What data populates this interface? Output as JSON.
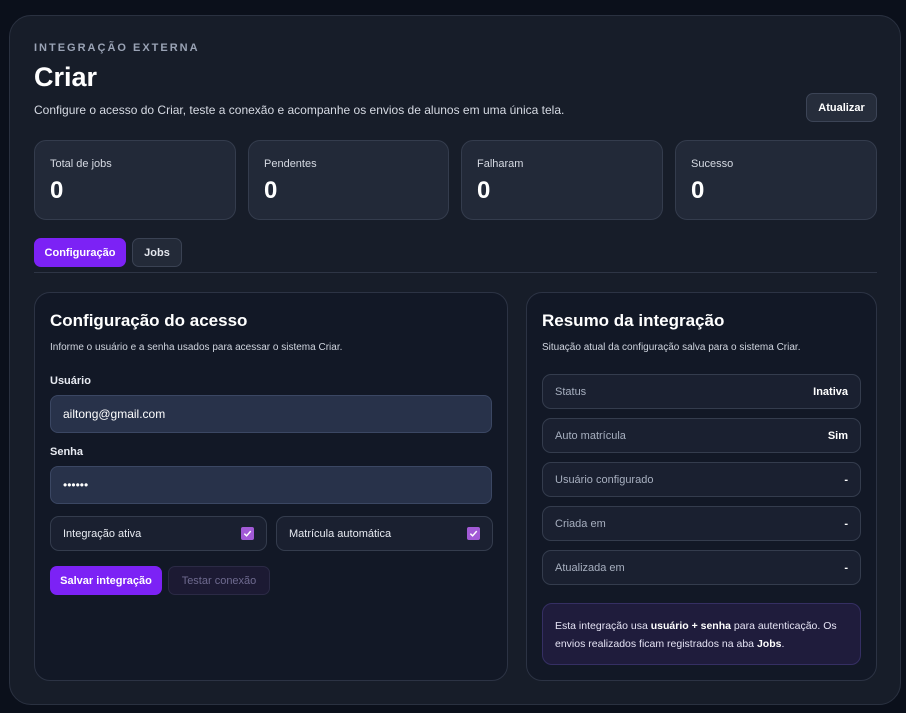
{
  "header": {
    "eyebrow": "INTEGRAÇÃO EXTERNA",
    "title": "Criar",
    "subtitle": "Configure o acesso do Criar, teste a conexão e acompanhe os envios de alunos em uma única tela.",
    "refresh_label": "Atualizar"
  },
  "stats": [
    {
      "label": "Total de jobs",
      "value": "0"
    },
    {
      "label": "Pendentes",
      "value": "0"
    },
    {
      "label": "Falharam",
      "value": "0"
    },
    {
      "label": "Sucesso",
      "value": "0"
    }
  ],
  "tabs": [
    {
      "label": "Configuração",
      "active": true
    },
    {
      "label": "Jobs",
      "active": false
    }
  ],
  "config": {
    "title": "Configuração do acesso",
    "description": "Informe o usuário e a senha usados para acessar o sistema Criar.",
    "user_label": "Usuário",
    "user_value": "ailtong@gmail.com",
    "password_label": "Senha",
    "password_value": "••••••",
    "toggle_active_label": "Integração ativa",
    "toggle_active_checked": true,
    "toggle_auto_label": "Matrícula automática",
    "toggle_auto_checked": true,
    "save_label": "Salvar integração",
    "test_label": "Testar conexão"
  },
  "summary": {
    "title": "Resumo da integração",
    "description": "Situação atual da configuração salva para o sistema Criar.",
    "rows": [
      {
        "key": "Status",
        "value": "Inativa"
      },
      {
        "key": "Auto matrícula",
        "value": "Sim"
      },
      {
        "key": "Usuário configurado",
        "value": "-"
      },
      {
        "key": "Criada em",
        "value": "-"
      },
      {
        "key": "Atualizada em",
        "value": "-"
      }
    ],
    "note": {
      "part1": "Esta integração usa ",
      "bold1": "usuário + senha",
      "part2": " para autenticação. Os envios realizados ficam registrados na aba ",
      "bold2": "Jobs",
      "part3": "."
    }
  },
  "colors": {
    "accent": "#7c22f5",
    "background": "#171d29",
    "checkbox": "#a25ad6"
  }
}
